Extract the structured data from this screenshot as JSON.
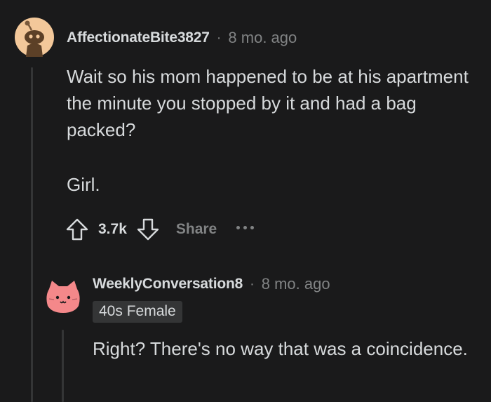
{
  "comment": {
    "username": "AffectionateBite3827",
    "separator": "·",
    "time": "8 mo. ago",
    "paragraphs": [
      "Wait so his mom happened to be at his apartment the minute you stopped by it and had a bag packed?",
      "Girl."
    ],
    "score": "3.7k",
    "share_label": "Share",
    "avatar_icon": "snoo-avatar-icon",
    "avatar_bg": "#f3c89a"
  },
  "reply": {
    "username": "WeeklyConversation8",
    "separator": "·",
    "time": "8 mo. ago",
    "flair": "40s Female",
    "text": "Right? There's no way that was a coincidence.",
    "avatar_icon": "cat-avatar-icon",
    "avatar_color": "#f4888a"
  },
  "colors": {
    "background": "#1a1a1b",
    "text": "#d7dadc",
    "muted": "#818384",
    "thread_line": "#343536"
  }
}
